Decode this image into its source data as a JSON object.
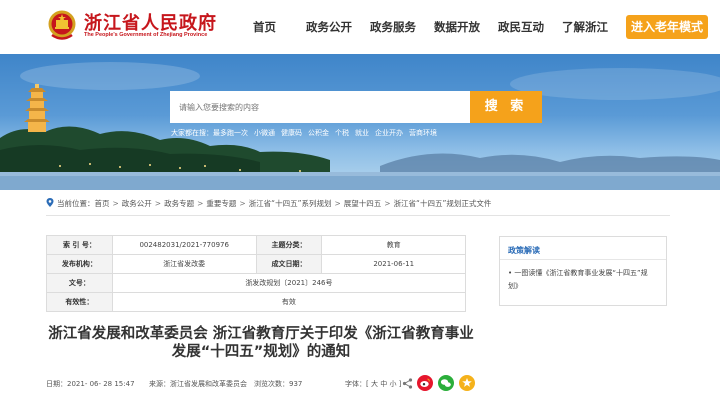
{
  "header": {
    "title": "浙江省人民政府",
    "subtitle": "The People's Government of Zhejiang Province",
    "nav": [
      "首页",
      "政务公开",
      "政务服务",
      "数据开放",
      "政民互动",
      "了解浙江"
    ],
    "elder_mode": "进入老年模式",
    "brand_color": "#c6161c",
    "accent_color": "#f5a21b"
  },
  "search": {
    "placeholder": "请输入您要搜索的内容",
    "button": "搜 索",
    "hot_label": "大家都在搜：",
    "hot_terms": [
      "最多跑一次",
      "小微通",
      "健康码",
      "公积金",
      "个税",
      "就业",
      "企业开办",
      "营商环境"
    ]
  },
  "breadcrumb": {
    "prefix": "当前位置：",
    "items": [
      "首页",
      "政务公开",
      "政务专题",
      "重要专题",
      "浙江省“十四五”系列规划",
      "展望十四五",
      "浙江省“十四五”规划正式文件"
    ]
  },
  "meta": {
    "index_label": "索 引 号：",
    "index_value": "002482031/2021-770976",
    "topic_label": "主题分类：",
    "topic_value": "教育",
    "org_label": "发布机构：",
    "org_value": "浙江省发改委",
    "date_label": "成文日期：",
    "date_value": "2021-06-11",
    "docno_label": "文号：",
    "docno_value": "浙发改规划〔2021〕246号",
    "validity_label": "有效性：",
    "validity_value": "有效"
  },
  "sidebar": {
    "title": "政策解读",
    "link": "一图读懂《浙江省教育事业发展“十四五”规划》"
  },
  "article": {
    "title": "浙江省发展和改革委员会 浙江省教育厅关于印发《浙江省教育事业发展“十四五”规划》的通知",
    "date_label": "日期：",
    "date": "2021- 06- 28 15:47",
    "source_label": "来源：",
    "source": "浙江省发展和改革委员会",
    "views_label": "浏览次数：",
    "views": "937",
    "font_label": "字体：[",
    "font_sizes": [
      "大",
      "中",
      "小"
    ],
    "font_close": "]"
  },
  "icons": [
    "emblem-icon",
    "location-pin-icon",
    "share-icon",
    "weibo-icon",
    "wechat-icon",
    "favorite-icon"
  ]
}
